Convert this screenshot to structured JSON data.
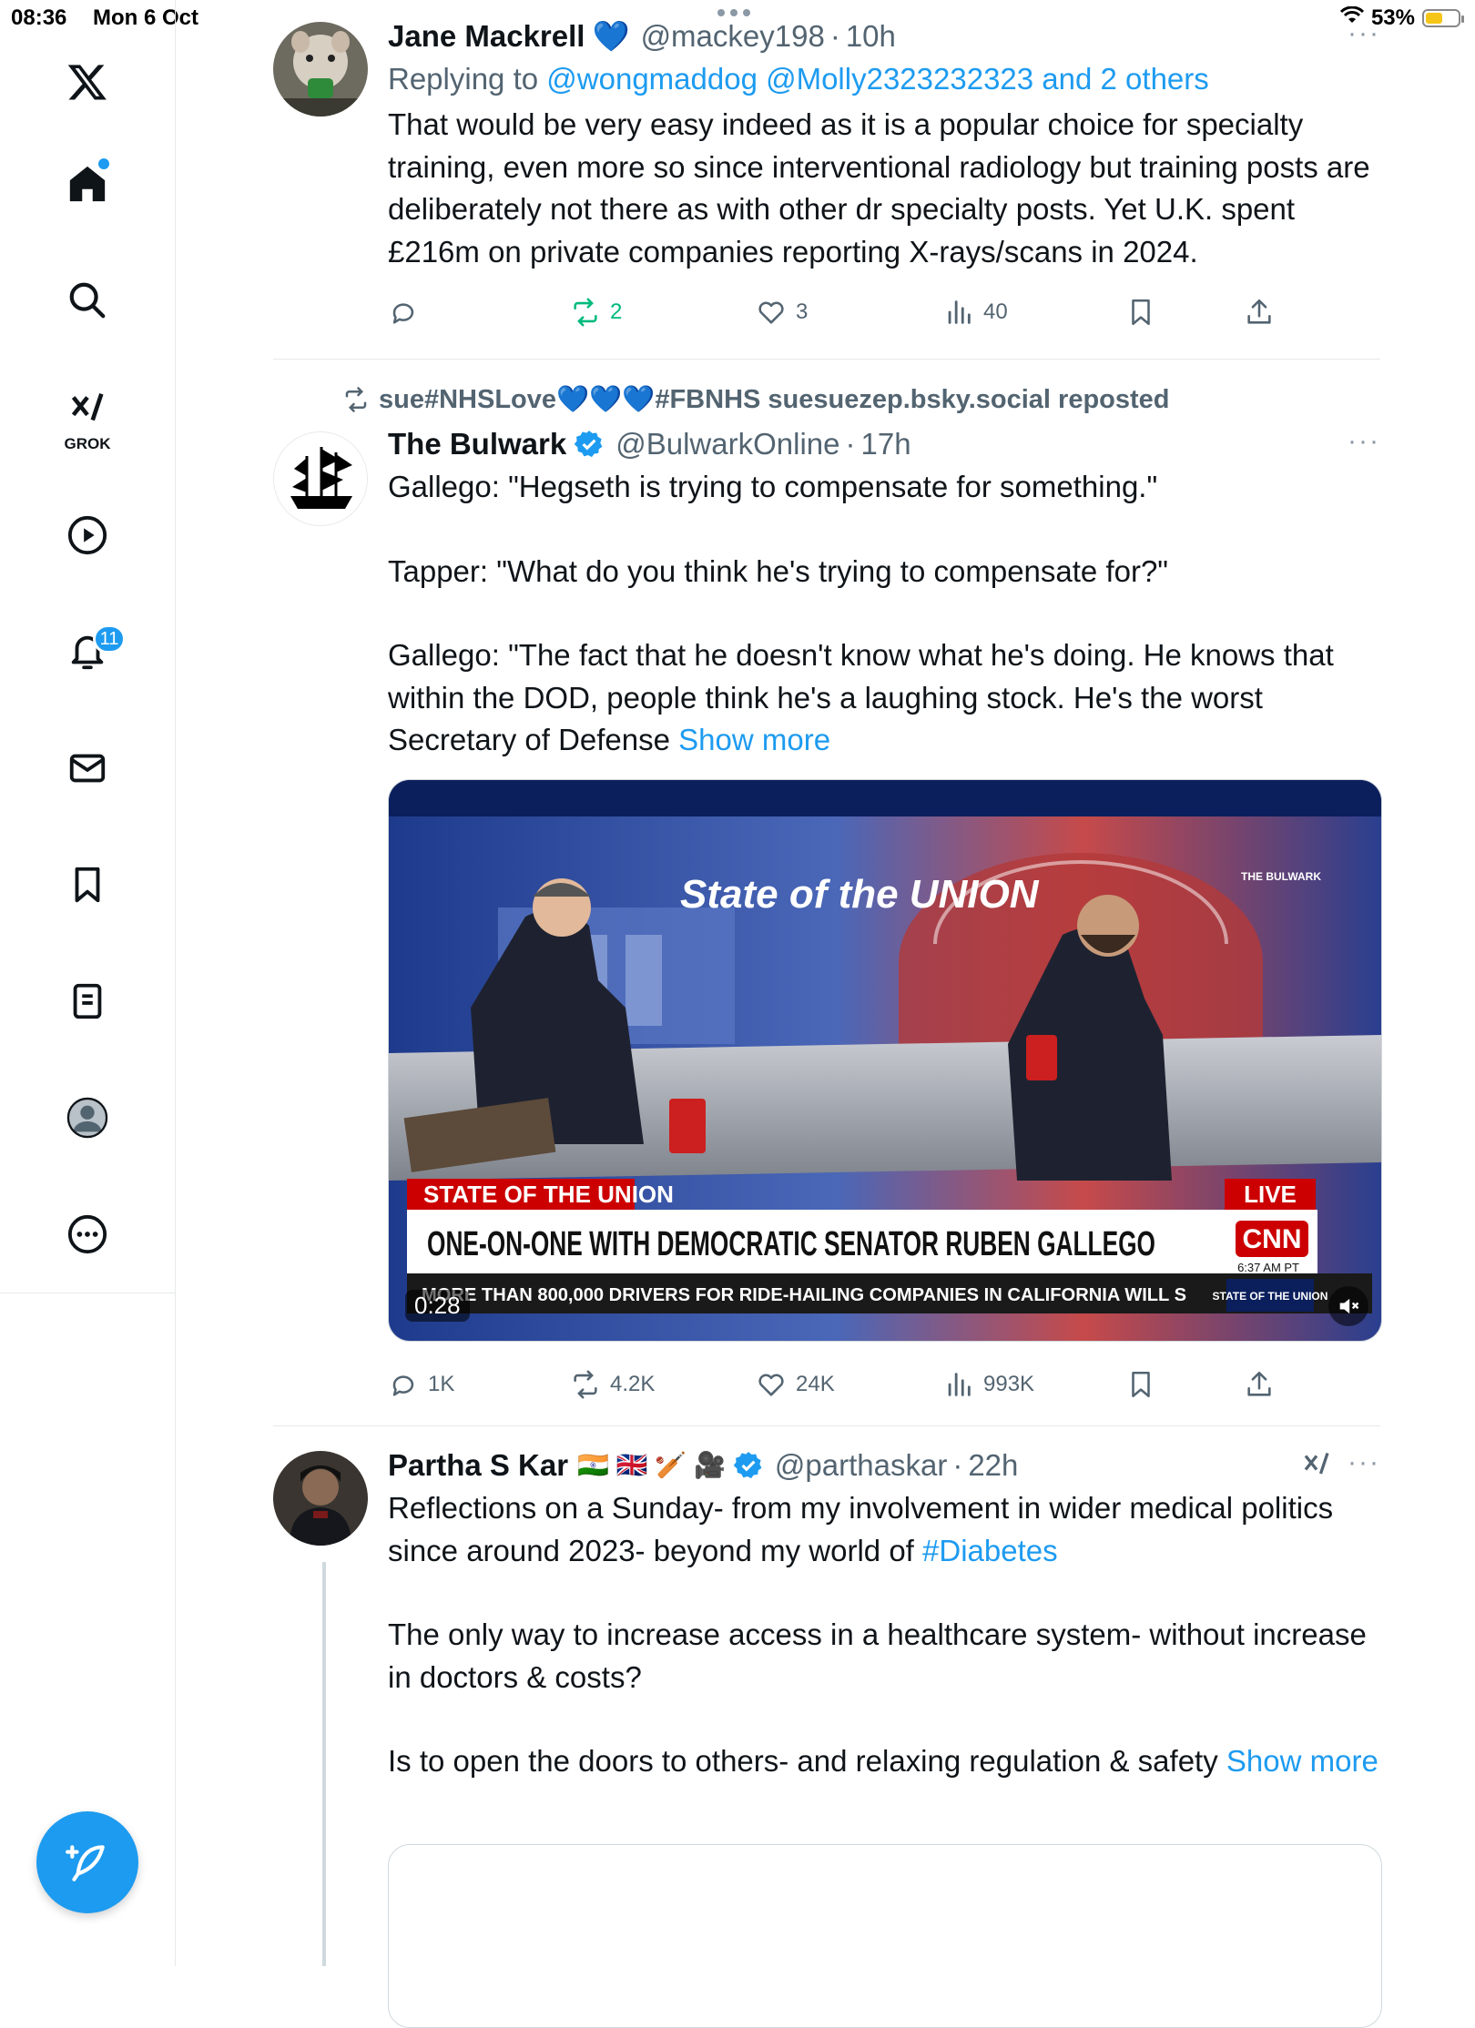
{
  "status_bar": {
    "time": "08:36",
    "date": "Mon 6 Oct",
    "battery": "53%",
    "battery_level": 0.53
  },
  "sidebar": {
    "items": [
      {
        "name": "x-logo-icon"
      },
      {
        "name": "home-icon"
      },
      {
        "name": "search-icon"
      },
      {
        "name": "grok-icon",
        "label": "GROK"
      },
      {
        "name": "video-icon"
      },
      {
        "name": "notifications-icon",
        "badge": "11"
      },
      {
        "name": "messages-icon"
      },
      {
        "name": "bookmarks-icon"
      },
      {
        "name": "lists-icon"
      },
      {
        "name": "profile-icon"
      },
      {
        "name": "more-icon"
      }
    ]
  },
  "tweets": [
    {
      "name": "Jane Mackrell",
      "emoji": "💙",
      "handle": "@mackey198",
      "time": "10h",
      "replying_prefix": "Replying to",
      "replying_to": "@wongmaddog @Molly2323232323 and 2 others",
      "text": "That would be very easy indeed as it is a popular choice for specialty training, even more so since interventional radiology but training posts are deliberately not there as with other dr specialty posts. Yet U.K. spent £216m on private companies reporting X-rays/scans in 2024.",
      "stats": {
        "replies": "",
        "reposts": "2",
        "likes": "3",
        "views": "40"
      }
    },
    {
      "repost_by": "sue#NHSLove💙💙💙#FBNHS suesuezep.bsky.social reposted",
      "name": "The Bulwark",
      "handle": "@BulwarkOnline",
      "time": "17h",
      "paragraphs": [
        "Gallego: \"Hegseth is trying to compensate for something.\"",
        "Tapper: \"What do you think he's trying to compensate for?\"",
        "Gallego: \"The fact that he doesn't know what he's doing. He knows that within the DOD, people think he's a laughing stock. He's the worst Secretary of Defense"
      ],
      "show_more": "Show more",
      "video": {
        "duration": "0:28",
        "program": "STATE OF THE UNION",
        "live": "LIVE",
        "headline": "ONE-ON-ONE WITH DEMOCRATIC SENATOR RUBEN GALLEGO",
        "ticker": "MORE THAN 800,000 DRIVERS FOR RIDE-HAILING COMPANIES IN CALIFORNIA WILL S",
        "clock": "6:37 AM PT",
        "network": "CNN",
        "show_logo": "State of the UNION",
        "sotu_small": "STATE OF THE UNION",
        "watermark": "THE BULWARK"
      },
      "stats": {
        "replies": "1K",
        "reposts": "4.2K",
        "likes": "24K",
        "views": "993K"
      }
    },
    {
      "name": "Partha S Kar",
      "emoji": "🇮🇳 🇬🇧 🏏 🎥",
      "handle": "@parthaskar",
      "time": "22h",
      "p1_text": "Reflections on a Sunday- from my involvement in wider medical politics since around 2023- beyond my world of ",
      "p1_hashtag": "#Diabetes",
      "p2": "The only way to increase access in a healthcare system- without increase in doctors & costs?",
      "p3_text": "Is to open the doors to others- and relaxing regulation & safety ",
      "show_more": "Show more"
    }
  ]
}
